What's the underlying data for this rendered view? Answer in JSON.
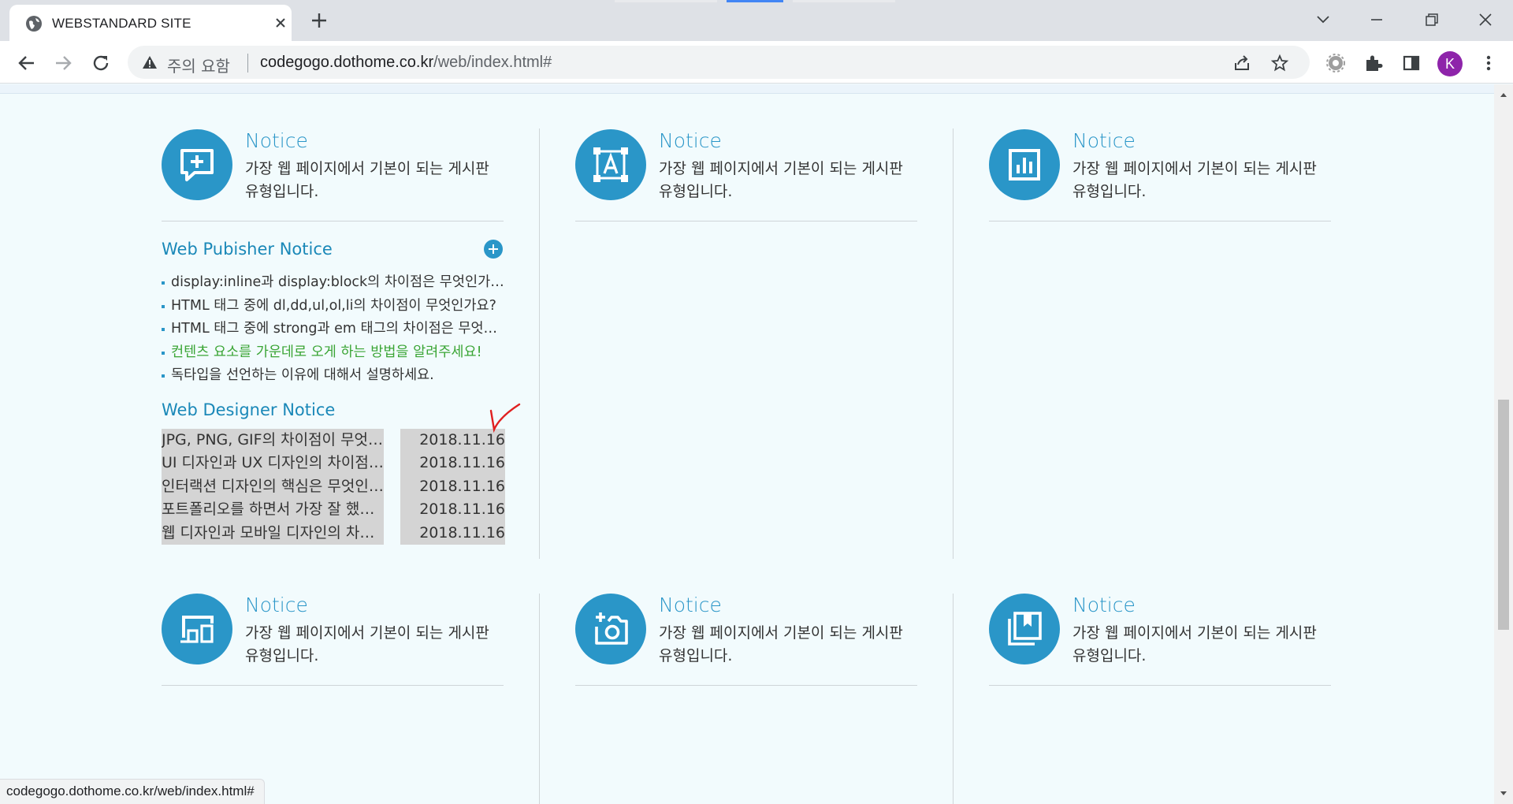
{
  "browser": {
    "tab_title": "WEBSTANDARD SITE",
    "security_label": "주의 요함",
    "url_host": "codegogo.dothome.co.kr",
    "url_path": "/web/index.html#",
    "avatar_initial": "K",
    "status_url": "codegogo.dothome.co.kr/web/index.html#"
  },
  "cards": [
    {
      "title": "Notice",
      "desc": "가장 웹 페이지에서 기본이 되는 게시판 유형입니다.",
      "icon": "comment-add-icon"
    },
    {
      "title": "Notice",
      "desc": "가장 웹 페이지에서 기본이 되는 게시판 유형입니다.",
      "icon": "text-frame-icon"
    },
    {
      "title": "Notice",
      "desc": "가장 웹 페이지에서 기본이 되는 게시판 유형입니다.",
      "icon": "bar-chart-icon"
    },
    {
      "title": "Notice",
      "desc": "가장 웹 페이지에서 기본이 되는 게시판 유형입니다.",
      "icon": "devices-icon"
    },
    {
      "title": "Notice",
      "desc": "가장 웹 페이지에서 기본이 되는 게시판 유형입니다.",
      "icon": "add-camera-icon"
    },
    {
      "title": "Notice",
      "desc": "가장 웹 페이지에서 기본이 되는 게시판 유형입니다.",
      "icon": "bookmarks-icon"
    }
  ],
  "publisher": {
    "title": "Web Pubisher Notice",
    "items": [
      "display:inline과 display:block의 차이점은 무엇인가요?",
      "HTML 태그 중에 dl,dd,ul,ol,li의 차이점이 무엇인가요?",
      "HTML 태그 중에 strong과 em 태그의 차이점은 무엇인가요?",
      "컨텐츠 요소를 가운데로 오게 하는 방법을 알려주세요!",
      "독타입을 선언하는 이유에 대해서 설명하세요."
    ],
    "highlight_index": 3
  },
  "designer": {
    "title": "Web Designer Notice",
    "rows": [
      {
        "title": "JPG, PNG, GIF의 차이점이 무엇인가요?",
        "date": "2018.11.16"
      },
      {
        "title": "UI 디자인과 UX 디자인의 차이점은?",
        "date": "2018.11.16"
      },
      {
        "title": "인터랙션 디자인의 핵심은 무엇인가요?",
        "date": "2018.11.16"
      },
      {
        "title": "포트폴리오를 하면서 가장 잘 했던 작업은?",
        "date": "2018.11.16"
      },
      {
        "title": "웹 디자인과 모바일 디자인의 차이점은?",
        "date": "2018.11.16"
      }
    ]
  },
  "colors": {
    "accent": "#2a96c8",
    "highlight_text": "#3aa535",
    "annotation": "#e02020"
  }
}
